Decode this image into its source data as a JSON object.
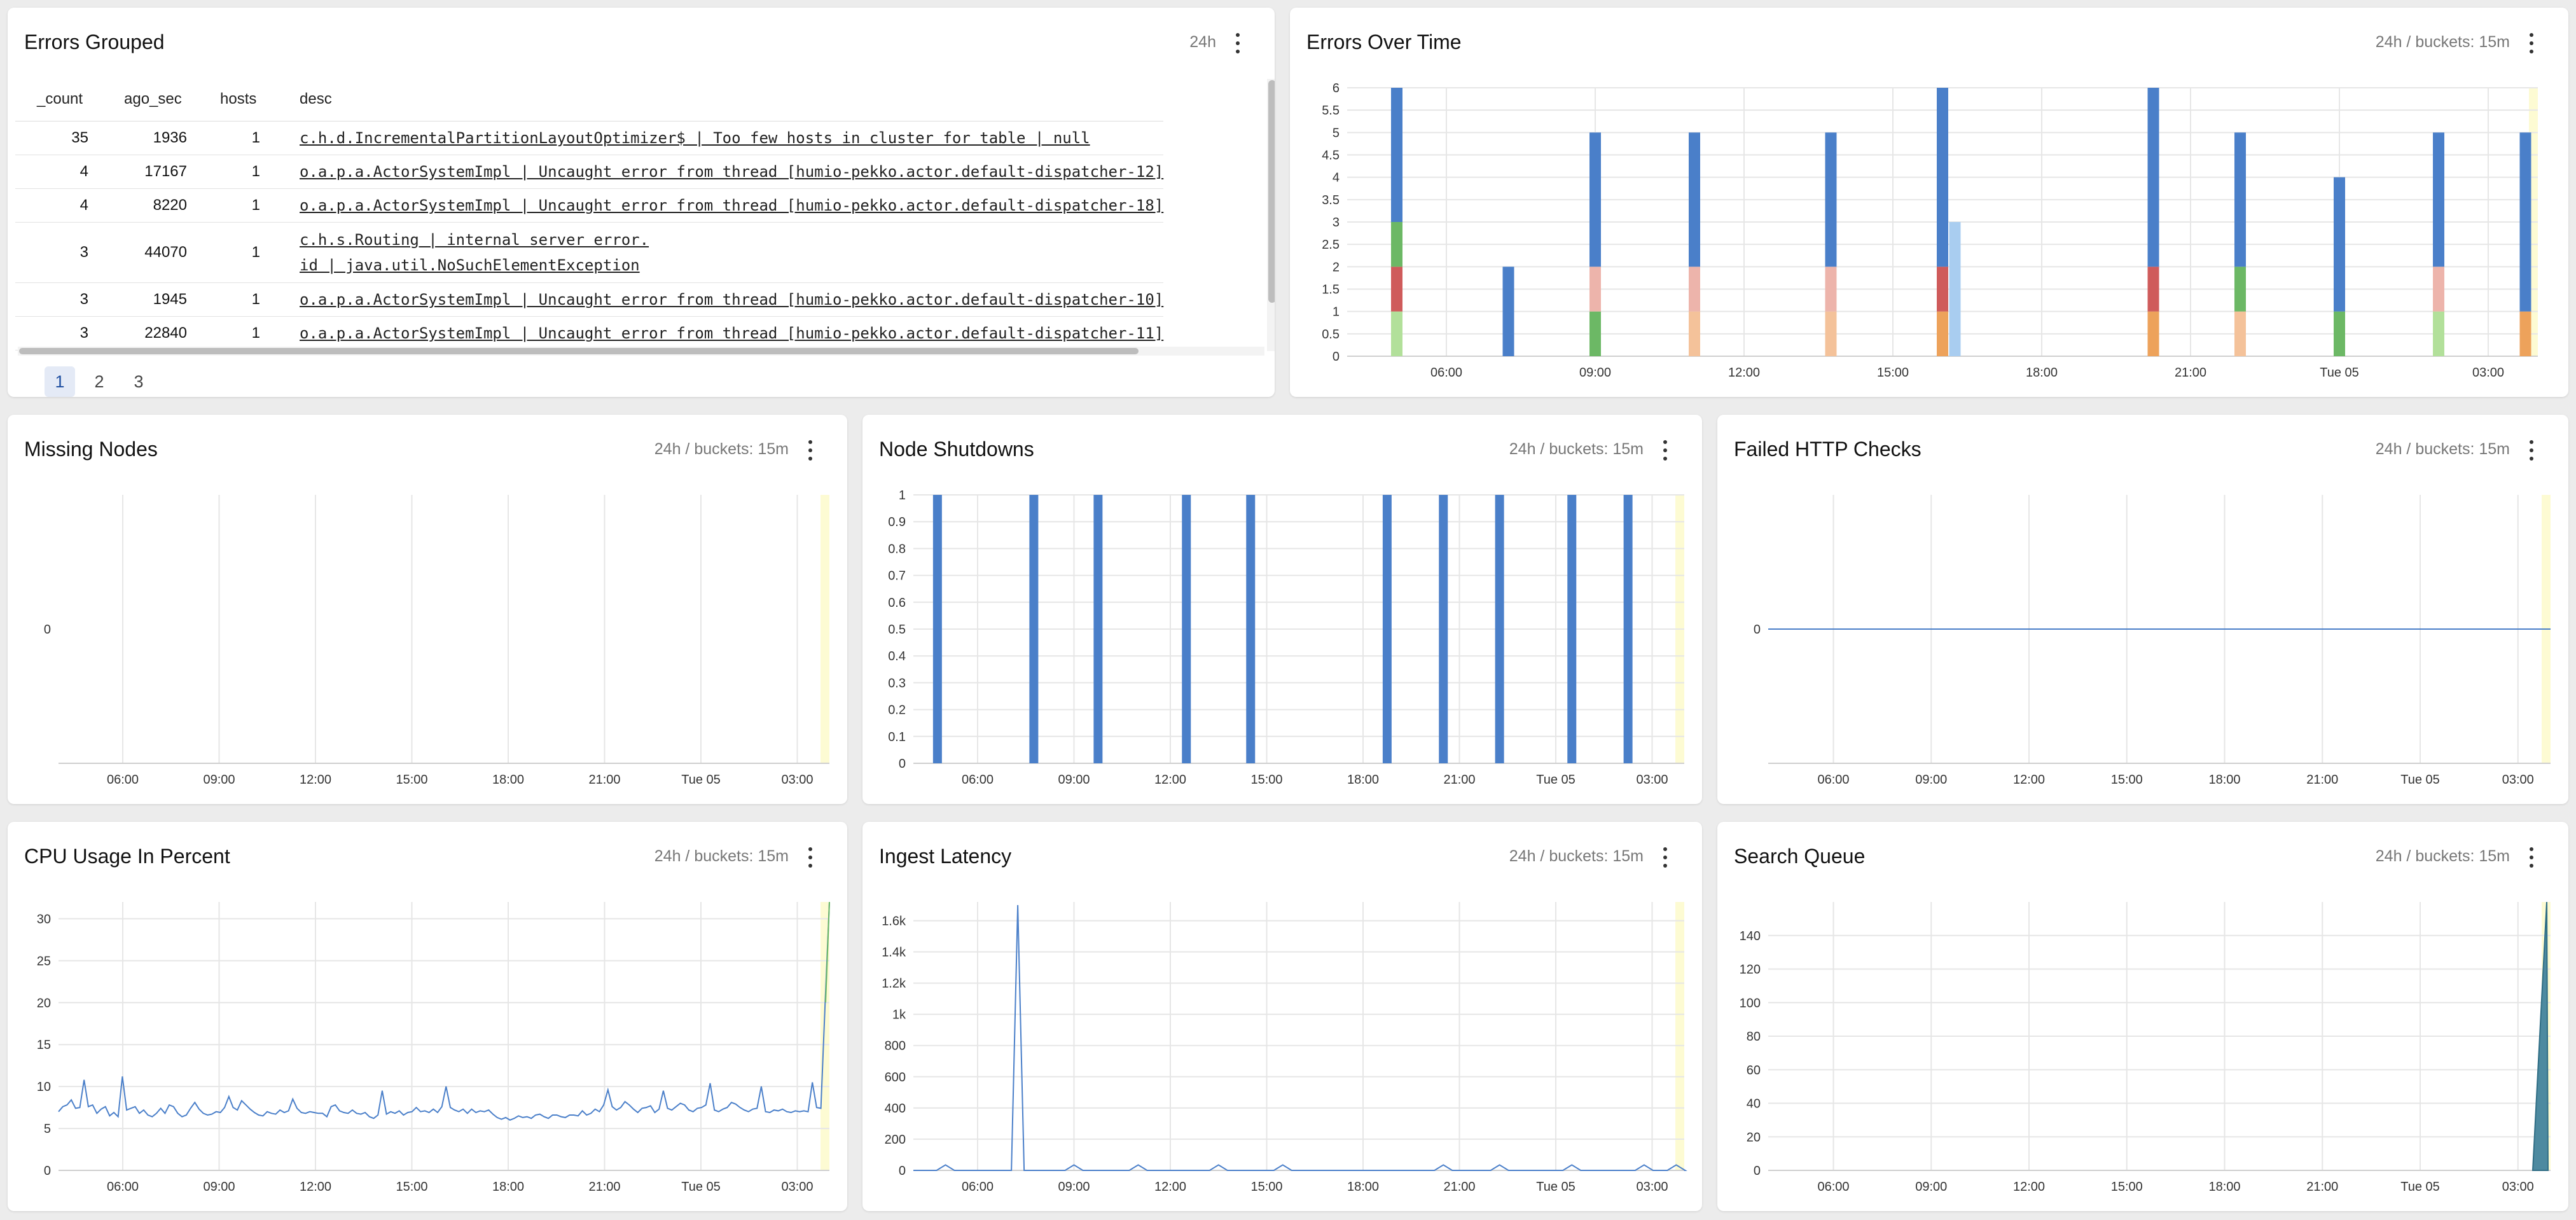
{
  "panels": {
    "errors_grouped": {
      "title": "Errors Grouped",
      "meta": "24h",
      "columns": [
        "_count",
        "ago_sec",
        "hosts",
        "desc"
      ],
      "rows": [
        {
          "count": "35",
          "ago_sec": "1936",
          "hosts": "1",
          "desc": "c.h.d.IncrementalPartitionLayoutOptimizer$ | Too few hosts in cluster for table | null"
        },
        {
          "count": "4",
          "ago_sec": "17167",
          "hosts": "1",
          "desc": "o.a.p.a.ActorSystemImpl | Uncaught error from thread [humio-pekko.actor.default-dispatcher-12]"
        },
        {
          "count": "4",
          "ago_sec": "8220",
          "hosts": "1",
          "desc": "o.a.p.a.ActorSystemImpl | Uncaught error from thread [humio-pekko.actor.default-dispatcher-18]"
        },
        {
          "count": "3",
          "ago_sec": "44070",
          "hosts": "1",
          "desc_line1": "c.h.s.Routing | internal server error.",
          "desc_line2": "id | java.util.NoSuchElementException"
        },
        {
          "count": "3",
          "ago_sec": "1945",
          "hosts": "1",
          "desc": "o.a.p.a.ActorSystemImpl | Uncaught error from thread [humio-pekko.actor.default-dispatcher-10]"
        },
        {
          "count": "3",
          "ago_sec": "22840",
          "hosts": "1",
          "desc": "o.a.p.a.ActorSystemImpl | Uncaught error from thread [humio-pekko.actor.default-dispatcher-11]"
        }
      ],
      "pages": [
        "1",
        "2",
        "3"
      ],
      "active_page": "1"
    },
    "errors_over_time": {
      "title": "Errors Over Time",
      "meta": "24h / buckets: 15m"
    },
    "missing_nodes": {
      "title": "Missing Nodes",
      "meta": "24h / buckets: 15m"
    },
    "node_shutdowns": {
      "title": "Node Shutdowns",
      "meta": "24h / buckets: 15m"
    },
    "failed_http_checks": {
      "title": "Failed HTTP Checks",
      "meta": "24h / buckets: 15m"
    },
    "cpu_usage": {
      "title": "CPU Usage In Percent",
      "meta": "24h / buckets: 15m"
    },
    "ingest_latency": {
      "title": "Ingest Latency",
      "meta": "24h / buckets: 15m"
    },
    "search_queue": {
      "title": "Search Queue",
      "meta": "24h / buckets: 15m"
    }
  },
  "colors": {
    "blue": "#4a7fc9",
    "green": "#6cb865",
    "light_green": "#b2e09a",
    "red": "#cf5b5b",
    "pink": "#edb4ab",
    "peach": "#f4c29a",
    "orange": "#eda25b",
    "light_blue": "#a9cdf0",
    "now_band": "#fdfbd3",
    "teal": "#4d8aa0"
  },
  "chart_data": [
    {
      "id": "errors_over_time",
      "type": "bar",
      "stacked": true,
      "x_ticks": [
        "06:00",
        "09:00",
        "12:00",
        "15:00",
        "18:00",
        "21:00",
        "Tue 05",
        "03:00"
      ],
      "y_ticks": [
        "0",
        "0.5",
        "1",
        "1.5",
        "2",
        "2.5",
        "3",
        "3.5",
        "4",
        "4.5",
        "5",
        "5.5",
        "6"
      ],
      "ylim": [
        0,
        6
      ],
      "series_colors": [
        "#b2e09a",
        "#cf5b5b",
        "#6cb865",
        "#4a7fc9",
        "#edb4ab",
        "#f4c29a",
        "#eda25b",
        "#a9cdf0"
      ],
      "bars": [
        {
          "t": "05:00",
          "segments": [
            {
              "c": 0,
              "v": 1
            },
            {
              "c": 1,
              "v": 1
            },
            {
              "c": 2,
              "v": 1
            },
            {
              "c": 3,
              "v": 3
            }
          ]
        },
        {
          "t": "07:15",
          "segments": [
            {
              "c": 3,
              "v": 2
            }
          ]
        },
        {
          "t": "09:00",
          "segments": [
            {
              "c": 2,
              "v": 1
            },
            {
              "c": 4,
              "v": 1
            },
            {
              "c": 3,
              "v": 3
            }
          ]
        },
        {
          "t": "11:00",
          "segments": [
            {
              "c": 5,
              "v": 1
            },
            {
              "c": 4,
              "v": 1
            },
            {
              "c": 3,
              "v": 3
            }
          ]
        },
        {
          "t": "13:45",
          "segments": [
            {
              "c": 5,
              "v": 1
            },
            {
              "c": 4,
              "v": 1
            },
            {
              "c": 3,
              "v": 3
            }
          ]
        },
        {
          "t": "16:00",
          "segments": [
            {
              "c": 6,
              "v": 1
            },
            {
              "c": 1,
              "v": 1
            },
            {
              "c": 3,
              "v": 4
            }
          ]
        },
        {
          "t": "16:15",
          "segments": [
            {
              "c": 7,
              "v": 3
            }
          ]
        },
        {
          "t": "20:15",
          "segments": [
            {
              "c": 6,
              "v": 1
            },
            {
              "c": 1,
              "v": 1
            },
            {
              "c": 3,
              "v": 4
            }
          ]
        },
        {
          "t": "22:00",
          "segments": [
            {
              "c": 5,
              "v": 1
            },
            {
              "c": 2,
              "v": 1
            },
            {
              "c": 3,
              "v": 3
            }
          ]
        },
        {
          "t": "00:00",
          "segments": [
            {
              "c": 2,
              "v": 1
            },
            {
              "c": 3,
              "v": 3
            }
          ]
        },
        {
          "t": "02:00",
          "segments": [
            {
              "c": 0,
              "v": 1
            },
            {
              "c": 4,
              "v": 1
            },
            {
              "c": 3,
              "v": 3
            }
          ]
        },
        {
          "t": "03:45",
          "segments": [
            {
              "c": 6,
              "v": 1
            },
            {
              "c": 3,
              "v": 4
            }
          ]
        }
      ]
    },
    {
      "id": "missing_nodes",
      "type": "line",
      "x_ticks": [
        "06:00",
        "09:00",
        "12:00",
        "15:00",
        "18:00",
        "21:00",
        "Tue 05",
        "03:00"
      ],
      "y_ticks": [
        "0"
      ],
      "values": []
    },
    {
      "id": "node_shutdowns",
      "type": "bar",
      "x_ticks": [
        "06:00",
        "09:00",
        "12:00",
        "15:00",
        "18:00",
        "21:00",
        "Tue 05",
        "03:00"
      ],
      "y_ticks": [
        "0",
        "0.1",
        "0.2",
        "0.3",
        "0.4",
        "0.5",
        "0.6",
        "0.7",
        "0.8",
        "0.9",
        "1"
      ],
      "ylim": [
        0,
        1
      ],
      "bars_at": [
        "04:45",
        "07:45",
        "09:45",
        "12:30",
        "14:30",
        "18:45",
        "20:30",
        "22:15",
        "00:30",
        "02:15"
      ],
      "bar_value": 1
    },
    {
      "id": "failed_http_checks",
      "type": "line",
      "x_ticks": [
        "06:00",
        "09:00",
        "12:00",
        "15:00",
        "18:00",
        "21:00",
        "Tue 05",
        "03:00"
      ],
      "y_ticks": [
        "0"
      ],
      "constant_value": 0
    },
    {
      "id": "cpu_usage",
      "type": "line",
      "x_ticks": [
        "06:00",
        "09:00",
        "12:00",
        "15:00",
        "18:00",
        "21:00",
        "Tue 05",
        "03:00"
      ],
      "y_ticks": [
        "0",
        "5",
        "10",
        "15",
        "20",
        "25",
        "30"
      ],
      "ylim": [
        0,
        32
      ],
      "values": [
        7,
        7.6,
        7.8,
        8.4,
        7.4,
        7.5,
        10.8,
        7.6,
        7.8,
        6.8,
        7.3,
        7.6,
        6.5,
        6.9,
        6.4,
        11.2,
        7.2,
        7.4,
        7.6,
        6.8,
        7.2,
        6.6,
        6.4,
        6.8,
        7.4,
        6.8,
        7.8,
        7.6,
        6.8,
        6.4,
        6.6,
        7.4,
        8.1,
        7.3,
        6.8,
        6.6,
        6.7,
        7.0,
        6.9,
        7.5,
        8.8,
        7.5,
        7.2,
        8.3,
        7.8,
        7.3,
        6.9,
        6.6,
        6.5,
        7.0,
        6.8,
        6.7,
        7.2,
        6.9,
        7.1,
        8.5,
        7.4,
        6.9,
        6.8,
        7.0,
        6.9,
        6.8,
        6.8,
        6.4,
        7.6,
        7.8,
        7.1,
        6.9,
        6.8,
        7.2,
        6.8,
        6.7,
        6.9,
        6.4,
        6.2,
        6.6,
        9.5,
        6.7,
        7.0,
        6.8,
        7.1,
        6.6,
        6.9,
        7.0,
        7.5,
        7.0,
        7.1,
        6.9,
        7.3,
        6.9,
        7.6,
        10.0,
        7.5,
        7.2,
        7.0,
        7.3,
        6.8,
        7.3,
        6.9,
        7.1,
        7.0,
        7.2,
        6.7,
        6.3,
        6.1,
        6.3,
        6.0,
        6.2,
        6.5,
        6.3,
        6.4,
        6.2,
        6.6,
        6.7,
        6.4,
        6.2,
        6.6,
        6.6,
        6.4,
        6.3,
        6.6,
        6.6,
        6.5,
        7.1,
        6.6,
        6.8,
        7.3,
        7.0,
        7.8,
        9.6,
        7.6,
        7.2,
        7.5,
        8.2,
        7.8,
        7.3,
        6.9,
        7.4,
        7.5,
        7.7,
        6.9,
        7.3,
        9.5,
        7.4,
        7.2,
        7.6,
        8.0,
        7.8,
        7.2,
        7.0,
        7.4,
        7.5,
        7.8,
        10.4,
        7.2,
        7.0,
        7.3,
        7.5,
        8.1,
        7.9,
        7.5,
        7.2,
        7.0,
        7.3,
        7.4,
        10.0,
        7.0,
        6.9,
        7.2,
        7.1,
        7.3,
        7.0,
        6.9,
        7.1,
        7.0,
        7.1,
        7.0,
        10.5,
        7.5,
        7.4,
        20.0,
        32.0
      ]
    },
    {
      "id": "ingest_latency",
      "type": "line",
      "x_ticks": [
        "06:00",
        "09:00",
        "12:00",
        "15:00",
        "18:00",
        "21:00",
        "Tue 05",
        "03:00"
      ],
      "y_ticks": [
        "0",
        "200",
        "400",
        "600",
        "800",
        "1k",
        "1.2k",
        "1.4k",
        "1.6k"
      ],
      "ylim": [
        0,
        1720
      ],
      "spike": {
        "t": "07:15",
        "value": 1700
      },
      "minor_bumps_at": [
        "05:00",
        "09:00",
        "11:00",
        "13:30",
        "15:30",
        "20:30",
        "22:15",
        "00:30",
        "02:45",
        "03:45"
      ],
      "minor_bump_value": 35
    },
    {
      "id": "search_queue",
      "type": "area",
      "x_ticks": [
        "06:00",
        "09:00",
        "12:00",
        "15:00",
        "18:00",
        "21:00",
        "Tue 05",
        "03:00"
      ],
      "y_ticks": [
        "0",
        "20",
        "40",
        "60",
        "80",
        "100",
        "120",
        "140"
      ],
      "ylim": [
        0,
        160
      ],
      "end_value": 160
    }
  ]
}
